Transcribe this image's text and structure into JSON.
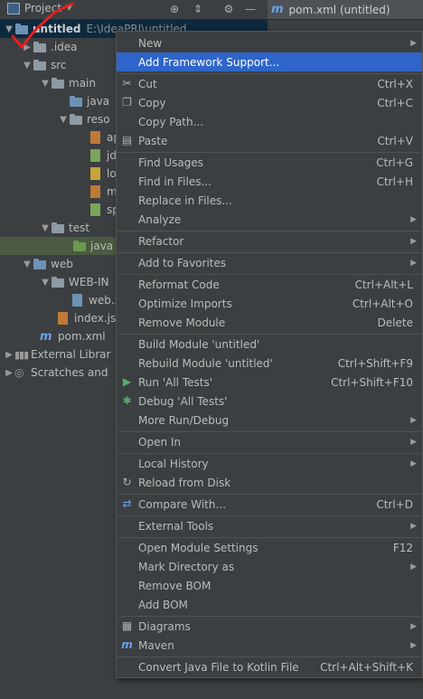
{
  "toolbar": {
    "project_label": "Project",
    "editor_tab": "pom.xml (untitled)"
  },
  "tree": [
    {
      "label": "untitled",
      "path": "E:\\IdeaPRJ\\untitled",
      "selected": true
    },
    {
      "label": ".idea"
    },
    {
      "label": "src"
    },
    {
      "label": "main"
    },
    {
      "label": "java"
    },
    {
      "label": "reso"
    },
    {
      "label": "ap"
    },
    {
      "label": "jd"
    },
    {
      "label": "lo"
    },
    {
      "label": "m"
    },
    {
      "label": "sp"
    },
    {
      "label": "test"
    },
    {
      "label": "java"
    },
    {
      "label": "web"
    },
    {
      "label": "WEB-IN"
    },
    {
      "label": "web.x"
    },
    {
      "label": "index.jsp"
    },
    {
      "label": "pom.xml"
    },
    {
      "label": "External Librar"
    },
    {
      "label": "Scratches and"
    }
  ],
  "menu": {
    "items": [
      {
        "label": "New",
        "shortcut": "",
        "submenu": true
      },
      {
        "label": "Add Framework Support...",
        "shortcut": ""
      },
      {
        "label": "Cut",
        "shortcut": "Ctrl+X"
      },
      {
        "label": "Copy",
        "shortcut": "Ctrl+C"
      },
      {
        "label": "Copy Path...",
        "shortcut": ""
      },
      {
        "label": "Paste",
        "shortcut": "Ctrl+V"
      },
      {
        "label": "Find Usages",
        "shortcut": "Ctrl+G"
      },
      {
        "label": "Find in Files...",
        "shortcut": "Ctrl+H"
      },
      {
        "label": "Replace in Files...",
        "shortcut": ""
      },
      {
        "label": "Analyze",
        "shortcut": "",
        "submenu": true
      },
      {
        "label": "Refactor",
        "shortcut": "",
        "submenu": true
      },
      {
        "label": "Add to Favorites",
        "shortcut": "",
        "submenu": true
      },
      {
        "label": "Reformat Code",
        "shortcut": "Ctrl+Alt+L"
      },
      {
        "label": "Optimize Imports",
        "shortcut": "Ctrl+Alt+O"
      },
      {
        "label": "Remove Module",
        "shortcut": "Delete"
      },
      {
        "label": "Build Module 'untitled'",
        "shortcut": ""
      },
      {
        "label": "Rebuild Module 'untitled'",
        "shortcut": "Ctrl+Shift+F9"
      },
      {
        "label": "Run 'All Tests'",
        "shortcut": "Ctrl+Shift+F10"
      },
      {
        "label": "Debug 'All Tests'",
        "shortcut": ""
      },
      {
        "label": "More Run/Debug",
        "shortcut": "",
        "submenu": true
      },
      {
        "label": "Open In",
        "shortcut": "",
        "submenu": true
      },
      {
        "label": "Local History",
        "shortcut": "",
        "submenu": true
      },
      {
        "label": "Reload from Disk",
        "shortcut": ""
      },
      {
        "label": "Compare With...",
        "shortcut": "Ctrl+D"
      },
      {
        "label": "External Tools",
        "shortcut": "",
        "submenu": true
      },
      {
        "label": "Open Module Settings",
        "shortcut": "F12"
      },
      {
        "label": "Mark Directory as",
        "shortcut": "",
        "submenu": true
      },
      {
        "label": "Remove BOM",
        "shortcut": ""
      },
      {
        "label": "Add BOM",
        "shortcut": ""
      },
      {
        "label": "Diagrams",
        "shortcut": "",
        "submenu": true
      },
      {
        "label": "Maven",
        "shortcut": "",
        "submenu": true
      },
      {
        "label": "Convert Java File to Kotlin File",
        "shortcut": "Ctrl+Alt+Shift+K"
      }
    ]
  },
  "colors": {
    "accent": "#2f65ca",
    "annotation": "#e02020"
  }
}
